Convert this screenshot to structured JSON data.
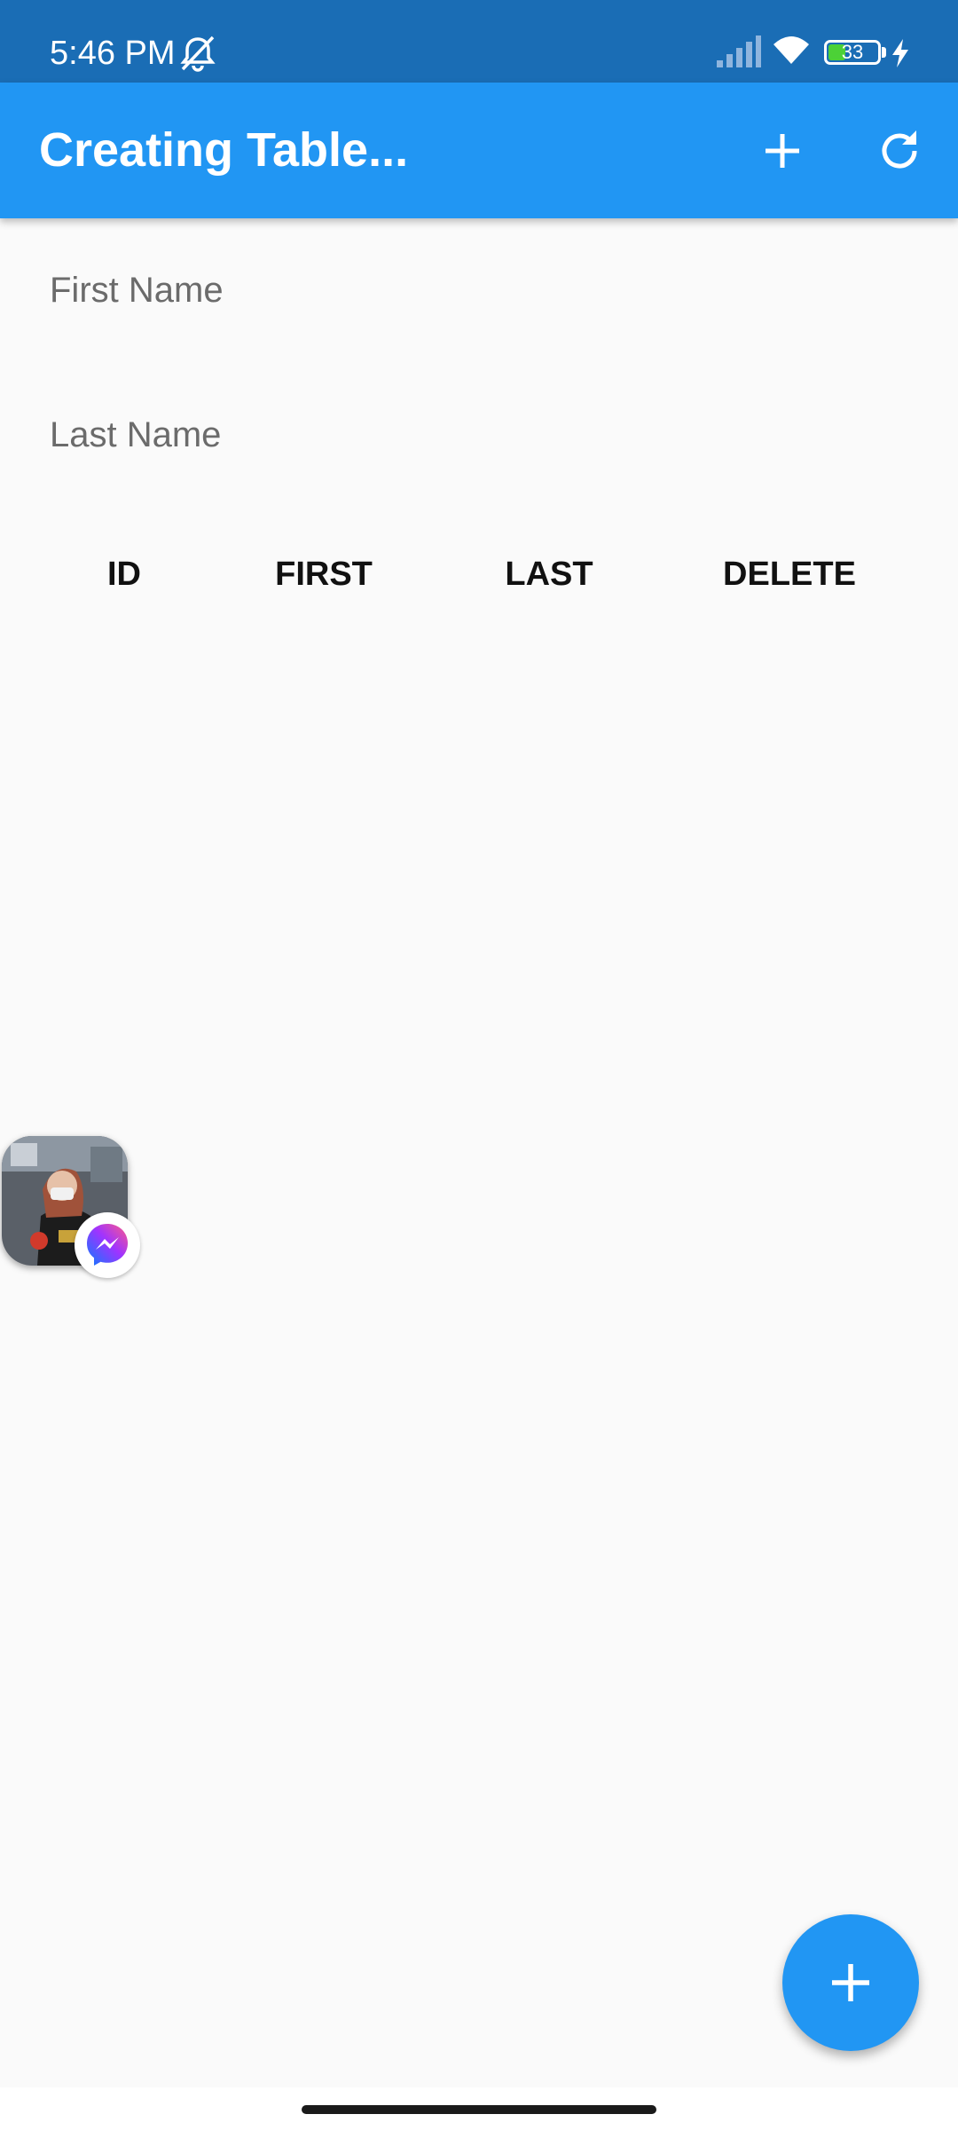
{
  "status_bar": {
    "time": "5:46 PM",
    "battery_level": "33",
    "icons": [
      "mute-icon",
      "signal-icon",
      "wifi-icon",
      "battery-icon",
      "charging-icon"
    ]
  },
  "app_bar": {
    "title": "Creating Table...",
    "actions": [
      "add-icon",
      "refresh-icon"
    ]
  },
  "form": {
    "first_name_label": "First Name",
    "last_name_label": "Last Name"
  },
  "table": {
    "columns": [
      "ID",
      "FIRST",
      "LAST",
      "DELETE"
    ],
    "rows": []
  },
  "colors": {
    "status_bar": "#1a6db5",
    "app_bar": "#2196f3",
    "fab": "#2196f3",
    "background": "#fafafa"
  }
}
